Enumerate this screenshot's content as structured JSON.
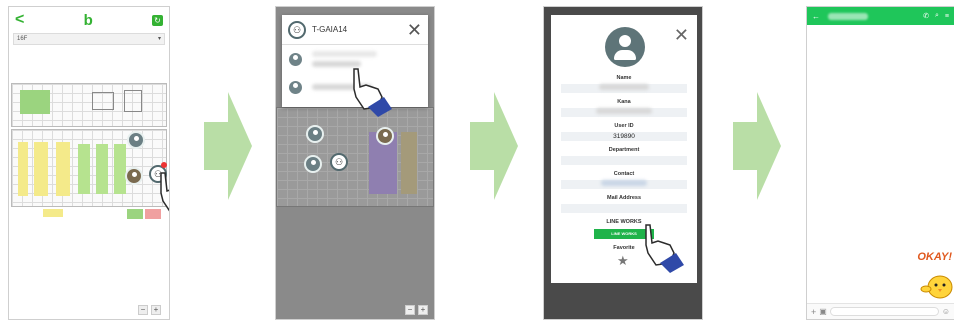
{
  "panel1": {
    "floor_label": "16F",
    "back_glyph": "<",
    "logo_glyph": "b",
    "refresh_glyph": "↻",
    "zoom_minus": "−",
    "zoom_plus": "+"
  },
  "panel2": {
    "popup_title": "T-GAIA14",
    "close_glyph": "✕",
    "zoom_minus": "−",
    "zoom_plus": "+"
  },
  "panel3": {
    "close_glyph": "✕",
    "fields": {
      "name_label": "Name",
      "kana_label": "Kana",
      "userid_label": "User ID",
      "userid_value": "319890",
      "department_label": "Department",
      "contact_label": "Contact",
      "mail_label": "Mail Address",
      "lineworks_label": "LINE WORKS",
      "lineworks_button": "LINE WORKS",
      "favorite_label": "Favorite"
    },
    "favorite_glyph": "★"
  },
  "panel4": {
    "back_glyph": "←",
    "phone_glyph": "✆",
    "search_glyph": "⌕",
    "menu_glyph": "≡",
    "plus_glyph": "+",
    "image_glyph": "▣",
    "emoji_glyph": "☺",
    "sticker_text": "OKAY!"
  },
  "colors": {
    "accent_green": "#1fc65a",
    "arrow_green": "#b9dea6",
    "hand_blue": "#2f49a8"
  }
}
